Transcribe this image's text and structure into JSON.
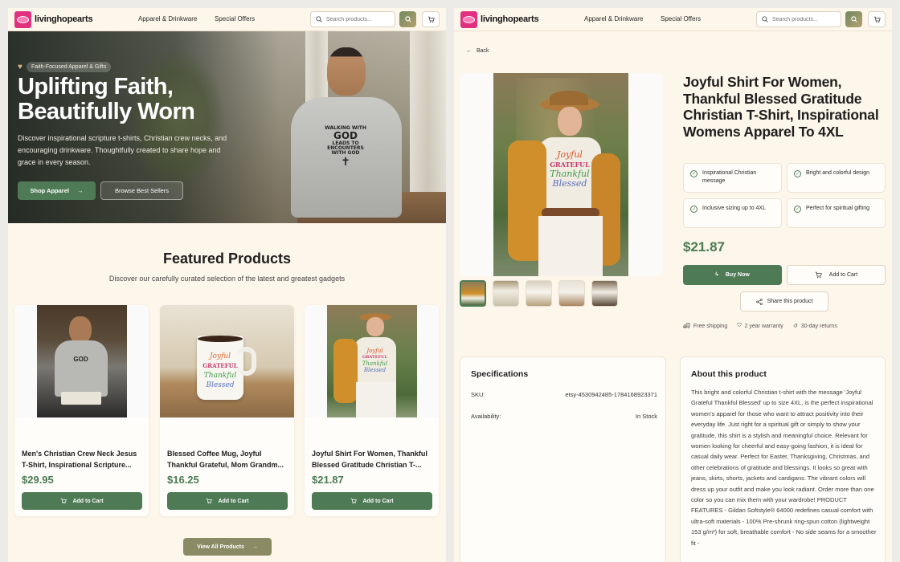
{
  "nav": {
    "brand": "livinghopearts",
    "links": [
      "Apparel & Drinkware",
      "Special Offers"
    ],
    "search_placeholder": "Search products...",
    "icons": [
      "search-icon",
      "cart-icon"
    ]
  },
  "hero": {
    "badge": "Faith-Focused Apparel & Gifts",
    "title": "Uplifting Faith, Beautifully Worn",
    "description": "Discover inspirational scripture t-shirts, Christian crew necks, and encouraging drinkware. Thoughtfully created to share hope and grace in every season.",
    "primary_button": "Shop Apparel",
    "secondary_button": "Browse Best Sellers",
    "shirt_text_1": "WALKING WITH",
    "shirt_text_2": "GOD",
    "shirt_text_3": "LEADS TO ENCOUNTERS WITH GOD"
  },
  "featured": {
    "title": "Featured Products",
    "subtitle": "Discover our carefully curated selection of the latest and greatest gadgets",
    "products": [
      {
        "name": "Men's Christian Crew Neck Jesus T-Shirt, Inspirational Scripture...",
        "price": "$29.95",
        "button": "Add to Cart"
      },
      {
        "name": "Blessed Coffee Mug, Joyful Thankful Grateful, Mom Grandm...",
        "price": "$16.25",
        "button": "Add to Cart"
      },
      {
        "name": "Joyful Shirt For Women, Thankful Blessed Gratitude Christian T-...",
        "price": "$21.87",
        "button": "Add to Cart"
      }
    ],
    "view_all": "View All Products"
  },
  "product": {
    "back": "Back",
    "title": "Joyful Shirt For Women, Thankful Blessed Gratitude Christian T-Shirt, Inspirational Womens Apparel To 4XL",
    "features": [
      "Inspirational Christian message",
      "Bright and colorful design",
      "Inclusive sizing up to 4XL",
      "Perfect for spiritual gifting"
    ],
    "price": "$21.87",
    "buy_now": "Buy Now",
    "add_to_cart": "Add to Cart",
    "share": "Share this product",
    "badges": [
      "Free shipping",
      "2 year warranty",
      "30-day returns"
    ],
    "shirt_words": [
      "Joyful",
      "GRATEFUL",
      "Thankful",
      "Blessed"
    ],
    "specs_title": "Specifications",
    "specs": [
      {
        "label": "SKU:",
        "value": "etsy-4530942485-1784168923371"
      },
      {
        "label": "Availability:",
        "value": "In Stock"
      }
    ],
    "about_title": "About this product",
    "about_text": "This bright and colorful Christian t-shirt with the message 'Joyful Grateful Thankful Blessed' up to size 4XL, is the perfect inspirational women's apparel for those who want to attract positivity into their everyday life. Just right for a spiritual gift or simply to show your gratitude, this shirt is a stylish and meaningful choice. Relevant for women looking for cheerful and easy-going fashion, it is ideal for casual daily wear. Perfect for Easter, Thanksgiving, Christmas, and other celebrations of gratitude and blessings. It looks so great with jeans, skirts, shorts, jackets and cardigans. The vibrant colors will dress up your outfit and make you look radiant. Order more than one color so you can mix them with your wardrobe! PRODUCT FEATURES - Gildan Softstyle® 64000 redefines casual comfort with ultra-soft materials - 100% Pre-shrunk ring-spun cotton (lightweight 153 g/m²) for soft, breathable comfort - No side seams for a smoother fit -"
  },
  "colors": {
    "accent": "#4e7a55",
    "price": "#4a7a52",
    "background": "#fdf6ea",
    "logo": "#e0307e"
  }
}
